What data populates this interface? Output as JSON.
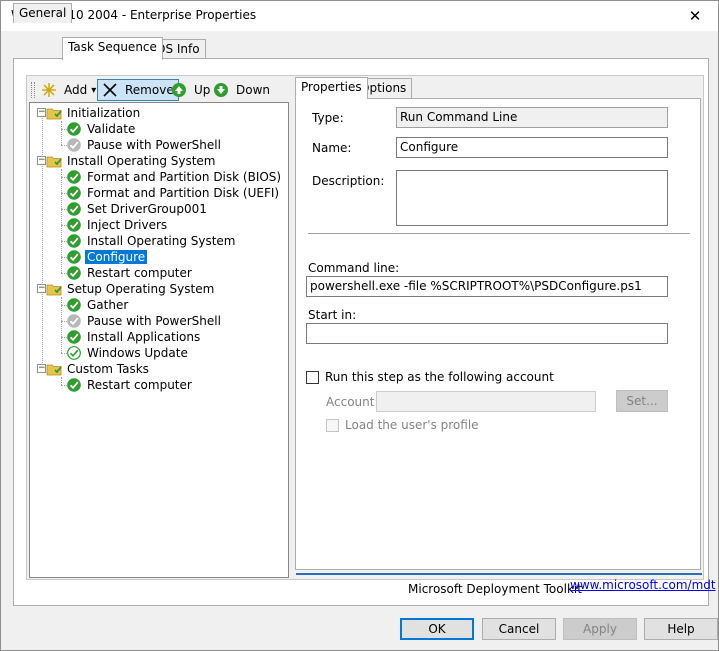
{
  "window": {
    "title": "Windows 10 2004 - Enterprise Properties",
    "close_glyph": "✕"
  },
  "tabs": [
    {
      "label": "General",
      "active": false
    },
    {
      "label": "Task Sequence",
      "active": true
    },
    {
      "label": "OS Info",
      "active": false
    }
  ],
  "toolbar": {
    "add_label": "Add",
    "add_dropdown_glyph": "▾",
    "remove_label": "Remove",
    "up_label": "Up",
    "down_label": "Down"
  },
  "tree": {
    "items": [
      {
        "label": "Initialization",
        "icon": "folder-icon",
        "level": 0
      },
      {
        "label": "Validate",
        "icon": "check-icon",
        "level": 1
      },
      {
        "label": "Pause with PowerShell",
        "icon": "disabled-step-icon",
        "level": 1
      },
      {
        "label": "Install Operating System",
        "icon": "folder-icon",
        "level": 0
      },
      {
        "label": "Format and Partition Disk (BIOS)",
        "icon": "check-icon",
        "level": 1
      },
      {
        "label": "Format and Partition Disk (UEFI)",
        "icon": "check-icon",
        "level": 1
      },
      {
        "label": "Set DriverGroup001",
        "icon": "check-icon",
        "level": 1
      },
      {
        "label": "Inject Drivers",
        "icon": "check-icon",
        "level": 1
      },
      {
        "label": "Install Operating System",
        "icon": "check-icon",
        "level": 1
      },
      {
        "label": "Configure",
        "icon": "check-icon",
        "level": 1,
        "selected": true
      },
      {
        "label": "Restart computer",
        "icon": "check-icon",
        "level": 1
      },
      {
        "label": "Setup Operating System",
        "icon": "folder-icon",
        "level": 0
      },
      {
        "label": "Gather",
        "icon": "check-icon",
        "level": 1
      },
      {
        "label": "Pause with PowerShell",
        "icon": "disabled-step-icon",
        "level": 1
      },
      {
        "label": "Install Applications",
        "icon": "check-icon",
        "level": 1
      },
      {
        "label": "Windows Update",
        "icon": "check-outline-icon",
        "level": 1
      },
      {
        "label": "Custom Tasks",
        "icon": "folder-icon",
        "level": 0
      },
      {
        "label": "Restart computer",
        "icon": "check-icon",
        "level": 1
      }
    ],
    "expander_glyph": "−"
  },
  "properties": {
    "tabs": [
      {
        "label": "Properties",
        "active": true
      },
      {
        "label": "Options",
        "active": false
      }
    ],
    "type_label": "Type:",
    "type_value": "Run Command Line",
    "name_label": "Name:",
    "name_value": "Configure",
    "description_label": "Description:",
    "description_value": "",
    "command_line_label": "Command line:",
    "command_line_value": "powershell.exe -file %SCRIPTROOT%\\PSDConfigure.ps1",
    "start_in_label": "Start in:",
    "start_in_value": "",
    "run_as_label": "Run this step as the following account",
    "run_as_checked": false,
    "account_label": "Account:",
    "account_value": "",
    "set_button_label": "Set...",
    "load_profile_label": "Load the user's profile",
    "load_profile_checked": false,
    "footer_brand": "Microsoft Deployment Toolkit",
    "footer_link": "www.microsoft.com/mdt"
  },
  "dialog_buttons": {
    "ok": "OK",
    "cancel": "Cancel",
    "apply": "Apply",
    "help": "Help"
  },
  "colors": {
    "selection": "#0078d7",
    "check_green": "#2e9e2e",
    "folder_yellow": "#e8c44a",
    "footer_bar": "#2a6dbf"
  }
}
